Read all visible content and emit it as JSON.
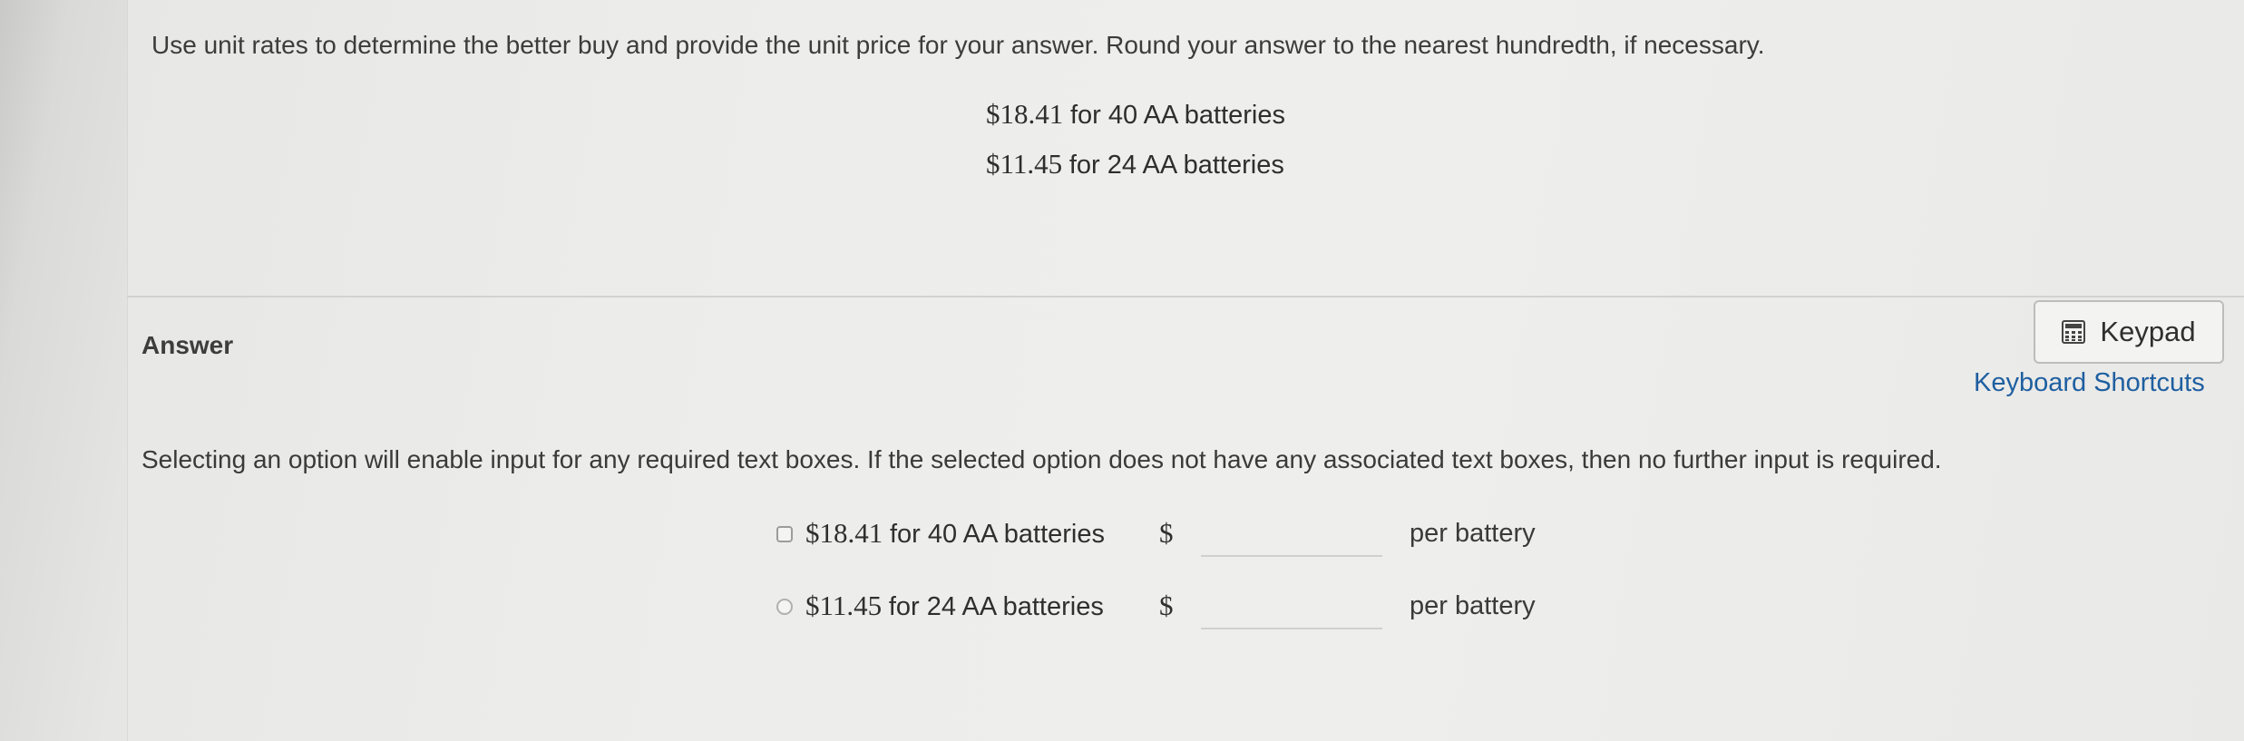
{
  "question": {
    "instruction": "Use unit rates to determine the better buy and provide the unit price for your answer. Round your answer to the nearest hundredth, if necessary.",
    "offers": [
      {
        "price": "$18.41",
        "desc": "for 40 AA batteries"
      },
      {
        "price": "$11.45",
        "desc": "for 24 AA batteries"
      }
    ]
  },
  "answer": {
    "label": "Answer",
    "keypad_label": "Keypad",
    "shortcuts_label": "Keyboard Shortcuts",
    "note": "Selecting an option will enable input for any required text boxes. If the selected option does not have any associated text boxes, then no further input is required.",
    "options": [
      {
        "price": "$18.41",
        "desc": "for 40 AA batteries",
        "currency": "$",
        "value": "",
        "unit_label": "per battery"
      },
      {
        "price": "$11.45",
        "desc": "for 24 AA batteries",
        "currency": "$",
        "value": "",
        "unit_label": "per battery"
      }
    ]
  },
  "icons": {
    "keypad": "calculator-icon"
  },
  "colors": {
    "link": "#1f5fa0",
    "background": "#ececea"
  }
}
